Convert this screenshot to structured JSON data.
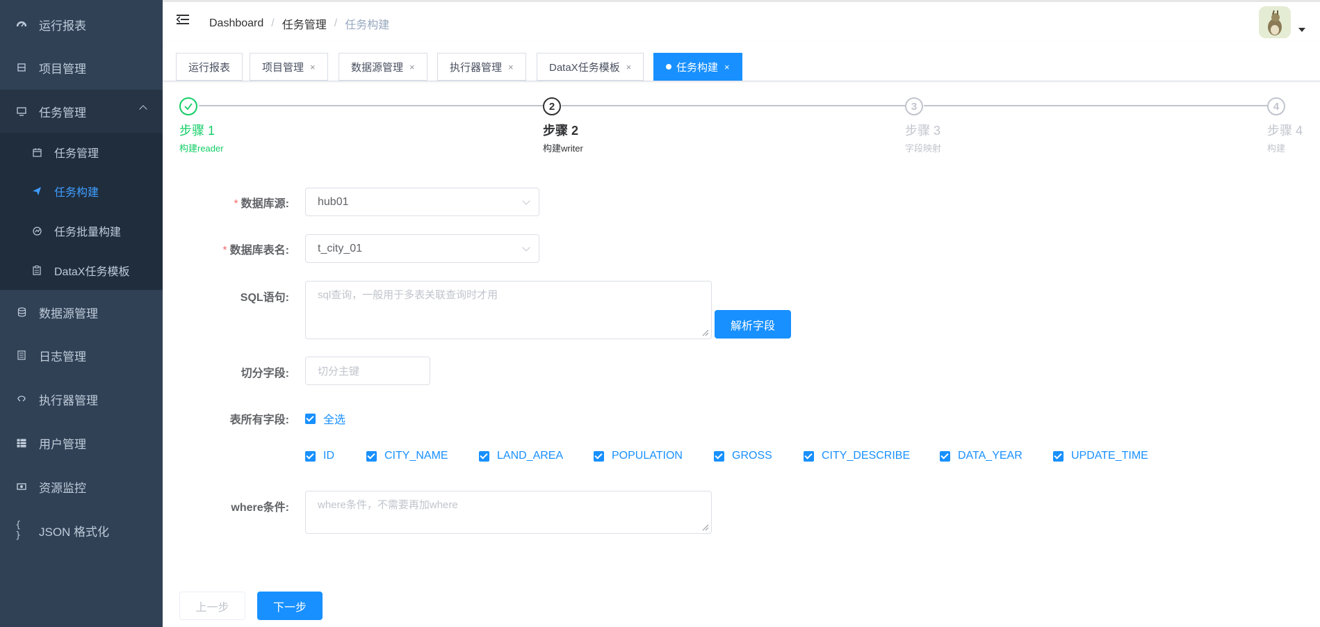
{
  "sidebar": {
    "items": [
      {
        "label": "运行报表",
        "icon": "dashboard-icon"
      },
      {
        "label": "项目管理",
        "icon": "project-icon"
      },
      {
        "label": "任务管理",
        "icon": "monitor-icon"
      },
      {
        "label": "数据源管理",
        "icon": "database-icon"
      },
      {
        "label": "日志管理",
        "icon": "log-icon"
      },
      {
        "label": "执行器管理",
        "icon": "executor-icon"
      },
      {
        "label": "用户管理",
        "icon": "user-table-icon"
      },
      {
        "label": "资源监控",
        "icon": "resource-icon"
      },
      {
        "label": "JSON 格式化",
        "icon": "json-icon"
      }
    ],
    "submenu": [
      {
        "label": "任务管理",
        "icon": "calendar-icon"
      },
      {
        "label": "任务构建",
        "icon": "send-icon"
      },
      {
        "label": "任务批量构建",
        "icon": "batch-icon"
      },
      {
        "label": "DataX任务模板",
        "icon": "clipboard-icon"
      }
    ],
    "active_submenu": "任务构建"
  },
  "navbar": {
    "breadcrumb": [
      "Dashboard",
      "任务管理",
      "任务构建"
    ],
    "separator": "/"
  },
  "tags": [
    {
      "label": "运行报表",
      "closable": false,
      "active": false
    },
    {
      "label": "项目管理",
      "closable": true,
      "active": false
    },
    {
      "label": "数据源管理",
      "closable": true,
      "active": false
    },
    {
      "label": "执行器管理",
      "closable": true,
      "active": false
    },
    {
      "label": "DataX任务模板",
      "closable": true,
      "active": false
    },
    {
      "label": "任务构建",
      "closable": true,
      "active": true
    }
  ],
  "tag_close_symbol": "×",
  "steps": [
    {
      "num": "1",
      "title": "步骤 1",
      "desc": "构建reader",
      "status": "success"
    },
    {
      "num": "2",
      "title": "步骤 2",
      "desc": "构建writer",
      "status": "process"
    },
    {
      "num": "3",
      "title": "步骤 3",
      "desc": "字段映射",
      "status": "wait"
    },
    {
      "num": "4",
      "title": "步骤 4",
      "desc": "构建",
      "status": "wait"
    }
  ],
  "form": {
    "datasource_label": "数据库源:",
    "datasource_value": "hub01",
    "table_label": "数据库表名:",
    "table_value": "t_city_01",
    "sql_label": "SQL语句:",
    "sql_placeholder": "sql查询，一般用于多表关联查询时才用",
    "parse_button": "解析字段",
    "split_label": "切分字段:",
    "split_placeholder": "切分主键",
    "fields_label": "表所有字段:",
    "select_all": "全选",
    "fields": [
      "ID",
      "CITY_NAME",
      "LAND_AREA",
      "POPULATION",
      "GROSS",
      "CITY_DESCRIBE",
      "DATA_YEAR",
      "UPDATE_TIME"
    ],
    "where_label": "where条件:",
    "where_placeholder": "where条件，不需要再加where",
    "required_mark": "*"
  },
  "buttons": {
    "prev": "上一步",
    "next": "下一步"
  },
  "colors": {
    "sidebar_bg": "#304156",
    "submenu_bg": "#1f2d3d",
    "primary": "#1890ff",
    "success": "#13ce66"
  }
}
